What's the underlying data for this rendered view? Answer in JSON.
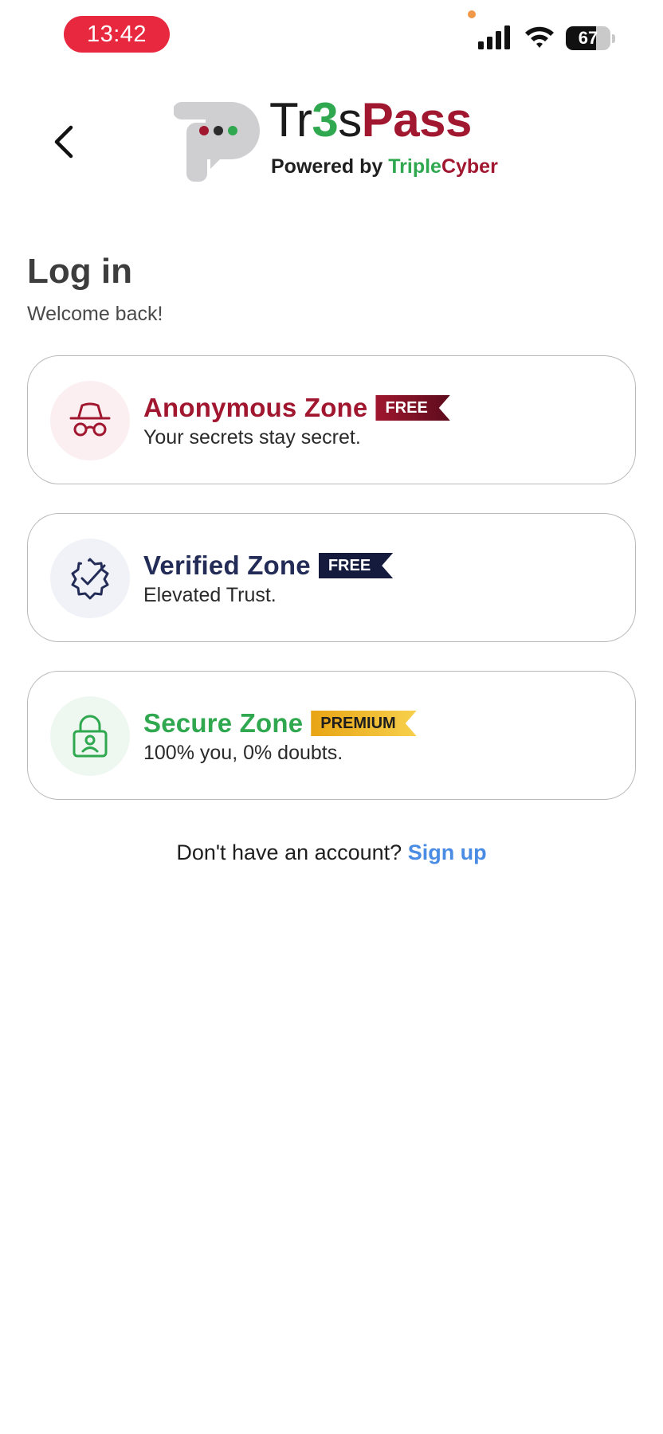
{
  "status_bar": {
    "time": "13:42",
    "battery_level": "67",
    "battery_fraction": 0.67,
    "icons": [
      "cellular-signal-icon",
      "wifi-icon",
      "battery-icon"
    ]
  },
  "header": {
    "back_icon": "chevron-left-icon",
    "brand": {
      "part1": "Tr",
      "part2": "3",
      "part3": "s",
      "part4": "Pass"
    },
    "powered": {
      "label": "Powered by ",
      "triple": "Triple",
      "cyber": "Cyber"
    }
  },
  "page": {
    "title": "Log in",
    "subtitle": "Welcome back!"
  },
  "zones": [
    {
      "title": "Anonymous Zone",
      "badge": "FREE",
      "description": "Your secrets stay secret.",
      "icon": "incognito-icon",
      "color": "#a0172f"
    },
    {
      "title": "Verified Zone",
      "badge": "FREE",
      "description": "Elevated Trust.",
      "icon": "verified-badge-icon",
      "color": "#232c57"
    },
    {
      "title": "Secure Zone",
      "badge": "PREMIUM",
      "description": "100% you, 0% doubts.",
      "icon": "lock-user-icon",
      "color": "#2fa84f"
    }
  ],
  "signup": {
    "prompt": "Don't have an account? ",
    "link": "Sign up",
    "link_color": "#4a8be3"
  },
  "colors": {
    "brand_red": "#a0172f",
    "brand_green": "#2fa84f",
    "time_pill": "#e8283f"
  }
}
